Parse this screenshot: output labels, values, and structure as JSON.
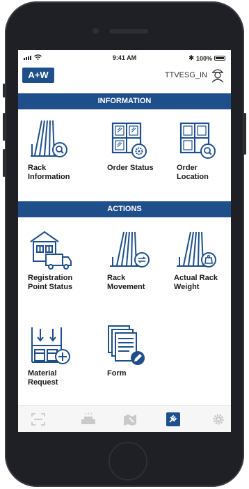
{
  "status": {
    "time": "9:41 AM",
    "battery": "100%"
  },
  "header": {
    "logo": "A+W",
    "username": "TTVESG_IN"
  },
  "sections": {
    "information": "INFORMATION",
    "actions": "ACTIONS"
  },
  "info_tiles": [
    {
      "line1": "Rack",
      "line2": "Information",
      "icon": "rack-search-icon"
    },
    {
      "line1": "Order Status",
      "line2": "",
      "icon": "window-gear-icon"
    },
    {
      "line1": "Order",
      "line2": "Location",
      "icon": "window-search-icon"
    }
  ],
  "action_tiles": [
    {
      "line1": "Registration",
      "line2": "Point Status",
      "icon": "warehouse-truck-icon"
    },
    {
      "line1": "Rack",
      "line2": "Movement",
      "icon": "rack-move-icon"
    },
    {
      "line1": "Actual Rack",
      "line2": "Weight",
      "icon": "rack-weight-icon"
    },
    {
      "line1": "Material",
      "line2": "Request",
      "icon": "shelf-add-icon"
    },
    {
      "line1": "Form",
      "line2": "",
      "icon": "form-edit-icon"
    }
  ],
  "tabbar": [
    "scan-icon",
    "delivery-icon",
    "map-icon",
    "tools-icon",
    "settings-icon"
  ],
  "colors": {
    "brand": "#1e4f8a",
    "icon_blue": "#1e4f8a",
    "tab_inactive": "#c9c9c9"
  }
}
